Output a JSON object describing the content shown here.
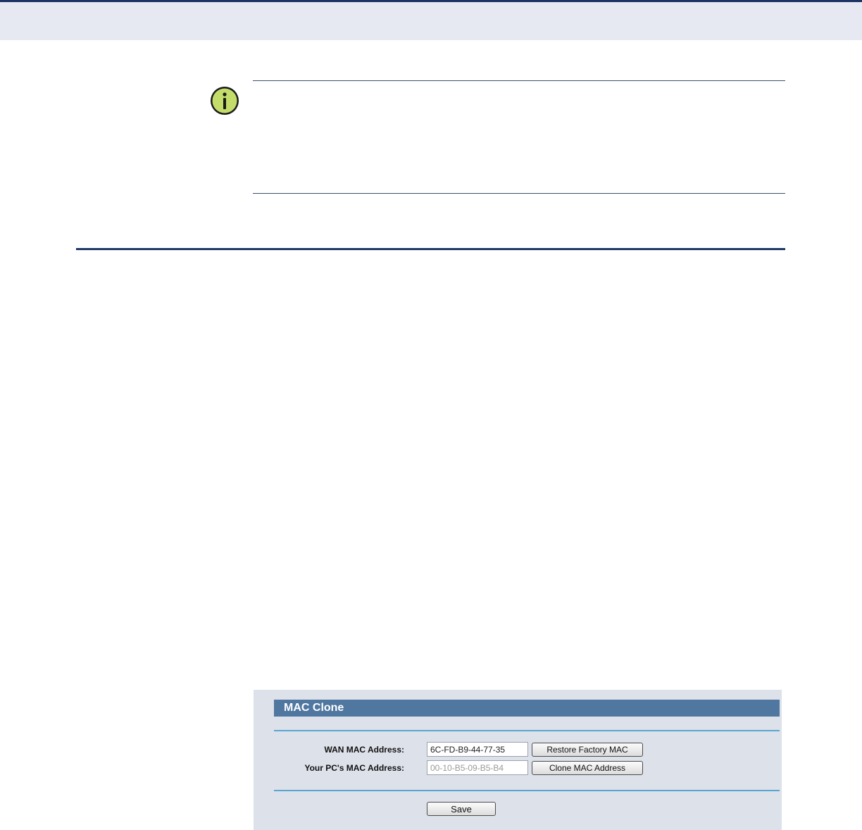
{
  "panel": {
    "title": "MAC Clone",
    "wan_label": "WAN MAC Address:",
    "wan_value": "6C-FD-B9-44-77-35",
    "restore_label": "Restore Factory MAC",
    "pc_label": "Your PC's MAC Address:",
    "pc_value": "00-10-B5-09-B5-B4",
    "clone_label": "Clone MAC Address",
    "save_label": "Save"
  },
  "icons": {
    "note": "info-icon"
  },
  "colors": {
    "header_band": "#e6e9f1",
    "header_border": "#1d3463",
    "panel_bg": "#dde1e9",
    "panel_title_bg": "#4f77a0",
    "panel_divider": "#59a6d4",
    "icon_fill": "#c4dd6a"
  }
}
